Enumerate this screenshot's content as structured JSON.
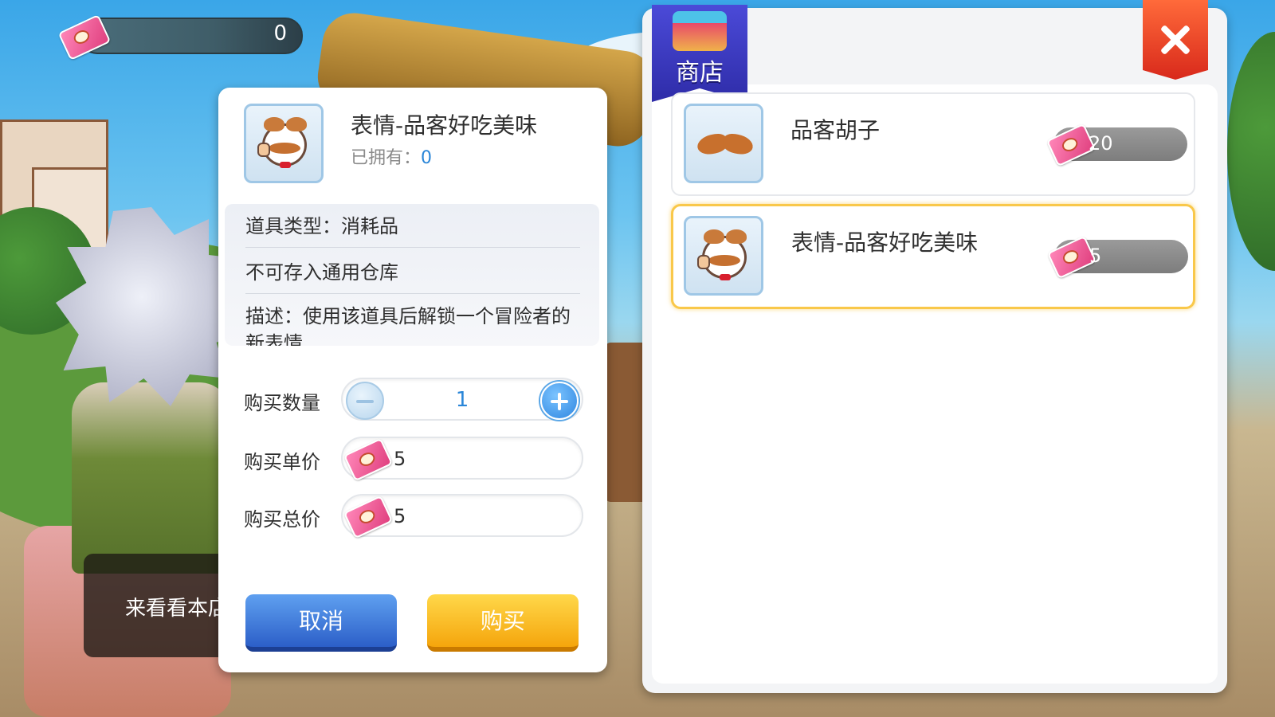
{
  "hud": {
    "currency_icon": "pringles-ticket-icon",
    "currency_value": "0"
  },
  "npc": {
    "dialog_text": "来看看本店"
  },
  "detail": {
    "item_name": "表情-品客好吃美味",
    "owned_label": "已拥有：",
    "owned_value": "0",
    "type_text": "道具类型：消耗品",
    "storage_text": "不可存入通用仓库",
    "description_text": "描述：使用该道具后解锁一个冒险者的新表情",
    "quantity_label": "购买数量",
    "quantity_value": "1",
    "unit_price_label": "购买单价",
    "unit_price_value": "5",
    "total_price_label": "购买总价",
    "total_price_value": "5",
    "cancel_label": "取消",
    "buy_label": "购买"
  },
  "shop": {
    "title": "商店",
    "items": [
      {
        "name": "品客胡子",
        "price": "20",
        "icon": "mustache-icon"
      },
      {
        "name": "表情-品客好吃美味",
        "price": "5",
        "icon": "pringles-emote-icon",
        "selected": true
      }
    ]
  },
  "colors": {
    "accent_blue": "#2a86d8",
    "buy_orange": "#f5a50c",
    "cancel_blue": "#2c5fc8",
    "close_red": "#d8291b",
    "selected_border": "#f9c84a"
  }
}
